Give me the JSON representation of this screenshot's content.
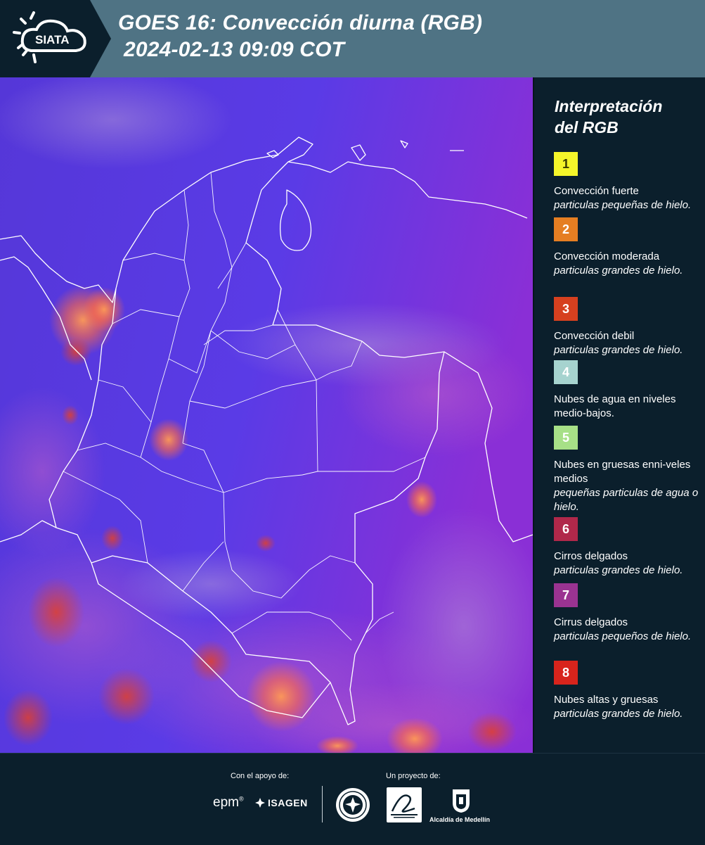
{
  "header": {
    "brand": "SIATA",
    "title_line1": "GOES 16: Convección diurna (RGB)",
    "title_line2": "2024-02-13 09:09 COT",
    "background_color": "#4f7384"
  },
  "legend": {
    "title_line1": "Interpretación",
    "title_line2": "del RGB",
    "items": [
      {
        "number": "1",
        "color": "#f5f52a",
        "text_color": "#3a3a00",
        "label": "Convección fuerte",
        "description": "particulas pequeñas de hielo."
      },
      {
        "number": "2",
        "color": "#e57e22",
        "text_color": "#ffffff",
        "label": "Convección moderada",
        "description": "particulas grandes de hielo."
      },
      {
        "number": "3",
        "color": "#d6401f",
        "text_color": "#ffffff",
        "label": "Convección debil",
        "description": "particulas grandes de hielo."
      },
      {
        "number": "4",
        "color": "#a6d3cf",
        "text_color": "#ffffff",
        "label": "Nubes de agua en niveles medio-bajos.",
        "description": ""
      },
      {
        "number": "5",
        "color": "#a7e087",
        "text_color": "#ffffff",
        "label": "Nubes en gruesas enni-veles medios",
        "description": "pequeñas particulas de agua o hielo."
      },
      {
        "number": "6",
        "color": "#b0284a",
        "text_color": "#ffffff",
        "label": "Cirros delgados",
        "description": "particulas grandes de hielo."
      },
      {
        "number": "7",
        "color": "#9a3391",
        "text_color": "#ffffff",
        "label": "Cirrus delgados",
        "description": "particulas pequeños de hielo."
      },
      {
        "number": "8",
        "color": "#d8241c",
        "text_color": "#ffffff",
        "label": "Nubes altas y gruesas",
        "description": "particulas grandes de hielo."
      }
    ]
  },
  "map": {
    "imagery_colors": {
      "background": "#5c3ee0",
      "east_tint": "#8b2ed8",
      "convection": "#ff6a3a"
    }
  },
  "footer": {
    "support_label": "Con el apoyo de:",
    "project_label": "Un proyecto de:",
    "partners": {
      "epm": "epm",
      "isagen": "ISAGEN",
      "alcaldia": "Alcaldía de Medellín"
    }
  }
}
